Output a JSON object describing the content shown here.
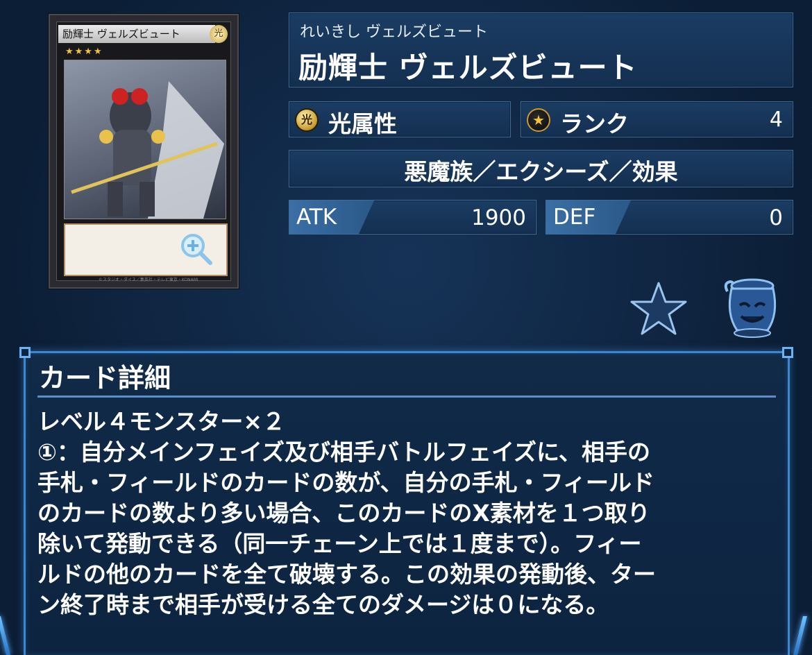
{
  "card": {
    "card_name_text": "励輝士 ヴェルズビュート",
    "attribute_glyph": "光",
    "rank_stars": "★★★★",
    "copyright": "©スタジオ・ダイス／集英社・テレビ東京・KONAMI"
  },
  "header": {
    "ruby": "れいきし ヴェルズビュート",
    "name": "励輝士 ヴェルズビュート"
  },
  "attribute": {
    "icon_glyph": "光",
    "label": "光属性"
  },
  "rank": {
    "icon_glyph": "★",
    "label": "ランク",
    "value": "4"
  },
  "type_line": "悪魔族／エクシーズ／効果",
  "stats": {
    "atk_label": "ATK",
    "atk_value": "1900",
    "def_label": "DEF",
    "def_value": "0"
  },
  "actions": {
    "favorite_icon": "star-icon",
    "pot_icon": "pot-of-greed-icon"
  },
  "detail": {
    "title": "カード詳細",
    "lines": [
      "レベル４モンスター×２",
      "①：自分メインフェイズ及び相手バトルフェイズに、相手の",
      "手札・フィールドのカードの数が、自分の手札・フィールド",
      "のカードの数より多い場合、このカードのX素材を１つ取り",
      "除いて発動できる（同一チェーン上では１度まで）。フィー",
      "ルドの他のカードを全て破壊する。この効果の発動後、ター",
      "ン終了時まで相手が受ける全てのダメージは０になる。"
    ]
  },
  "colors": {
    "accent": "#3d86d2",
    "panel": "#1b3c63",
    "gold": "#f3c43b"
  }
}
